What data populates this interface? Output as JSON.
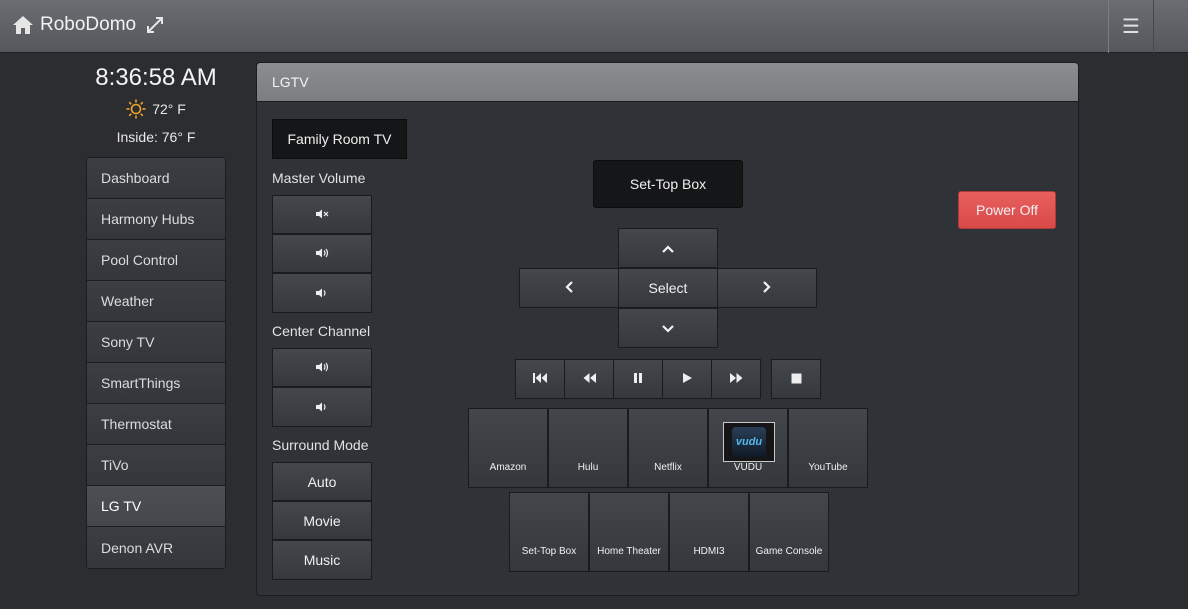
{
  "header": {
    "title": "RoboDomo",
    "home_icon": "home-icon",
    "expand_icon": "expand-icon",
    "menu_icon": "hamburger-menu-icon"
  },
  "status": {
    "time": "8:36:58 AM",
    "outside_temp": "72° F",
    "weather_icon": "sun-icon",
    "inside_temp": "Inside: 76° F"
  },
  "sidebar": {
    "items": [
      {
        "label": "Dashboard"
      },
      {
        "label": "Harmony Hubs"
      },
      {
        "label": "Pool Control"
      },
      {
        "label": "Weather"
      },
      {
        "label": "Sony TV"
      },
      {
        "label": "SmartThings"
      },
      {
        "label": "Thermostat"
      },
      {
        "label": "TiVo"
      },
      {
        "label": "LG TV",
        "active": true
      },
      {
        "label": "Denon AVR"
      }
    ]
  },
  "panel": {
    "title": "LGTV",
    "device_button": "Family Room TV",
    "master_volume_label": "Master Volume",
    "center_channel_label": "Center Channel",
    "surround_mode_label": "Surround Mode",
    "surround_modes": [
      "Auto",
      "Movie",
      "Music"
    ],
    "input_button": "Set-Top Box",
    "power_button": "Power Off",
    "select_label": "Select",
    "apps": [
      {
        "label": "Amazon"
      },
      {
        "label": "Hulu"
      },
      {
        "label": "Netflix"
      },
      {
        "label": "VUDU",
        "logo_text": "vudu"
      },
      {
        "label": "YouTube"
      }
    ],
    "inputs": [
      {
        "label": "Set-Top Box"
      },
      {
        "label": "Home Theater"
      },
      {
        "label": "HDMI3"
      },
      {
        "label": "Game Console"
      }
    ]
  },
  "colors": {
    "power": "#e0524f",
    "background": "#2b2d31",
    "header": "#7f8184"
  }
}
